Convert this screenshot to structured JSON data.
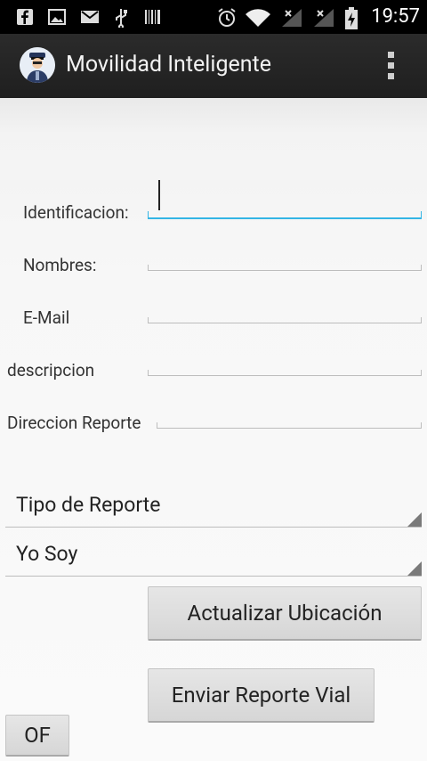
{
  "statusbar": {
    "left_icons": [
      "facebook-icon",
      "image-icon",
      "gmail-icon",
      "usb-icon",
      "barcode-icon"
    ],
    "right_icons": [
      "alarm-icon",
      "wifi-icon",
      "signal-icon",
      "signal-icon",
      "battery-charging-icon"
    ],
    "time": "19:57"
  },
  "actionbar": {
    "title": "Movilidad Inteligente",
    "app_icon": "police-avatar-icon",
    "overflow_icon": "overflow-menu-icon"
  },
  "form": {
    "identificacion_label": "Identificacion:",
    "nombres_label": "Nombres:",
    "email_label": "E-Mail",
    "descripcion_label": "descripcion",
    "direccion_label": "Direccion Reporte",
    "identificacion_value": "",
    "nombres_value": "",
    "email_value": "",
    "descripcion_value": "",
    "direccion_value": ""
  },
  "spinners": {
    "tipo_reporte": "Tipo de Reporte",
    "yo_soy": "Yo Soy"
  },
  "buttons": {
    "actualizar": "Actualizar Ubicación",
    "enviar": "Enviar Reporte Vial",
    "of": "OF"
  },
  "colors": {
    "accent": "#33b5e5",
    "actionbar": "#262626",
    "statusbar": "#000000"
  }
}
